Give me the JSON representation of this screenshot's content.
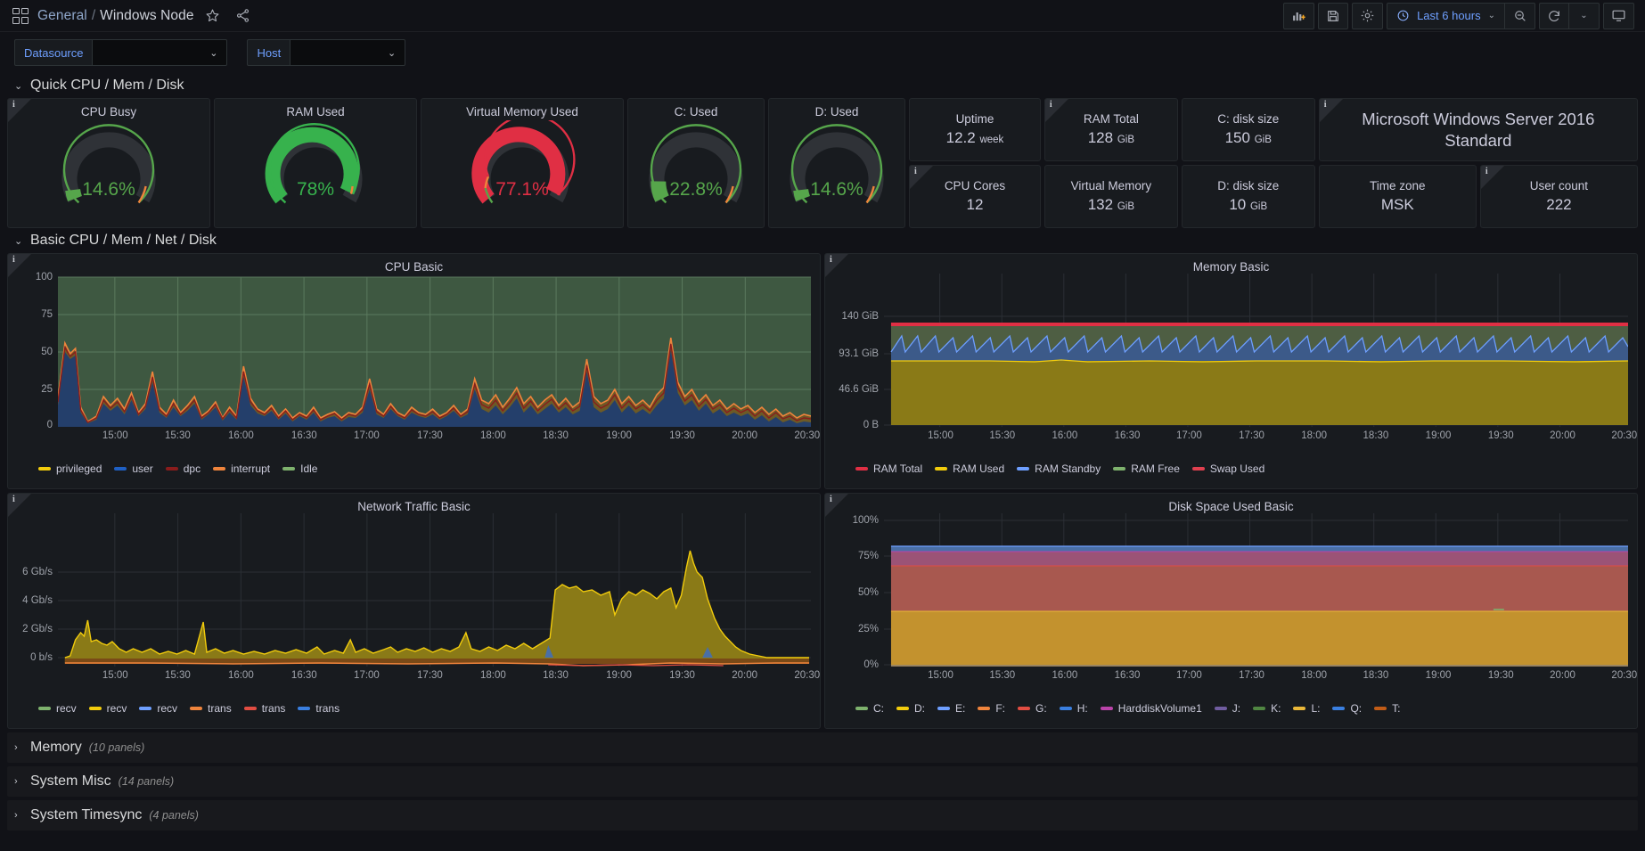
{
  "nav": {
    "breadcrumb_root": "General",
    "breadcrumb_sep": "/",
    "breadcrumb_current": "Windows Node",
    "star_icon": "star-icon",
    "share_icon": "share-icon",
    "grid_icon": "dashboard-grid-icon",
    "add_panel_label": "add-panel-icon",
    "save_label": "save-icon",
    "settings_label": "settings-gear-icon",
    "time_range": "Last 6 hours",
    "zoom_out_label": "zoom-out-icon",
    "refresh_label": "refresh-icon",
    "refresh_interval_caret": "⌄",
    "tv_label": "tv-mode-icon"
  },
  "variables": [
    {
      "label": "Datasource",
      "value": "",
      "name": "datasource"
    },
    {
      "label": "Host",
      "value": "",
      "name": "host"
    }
  ],
  "rows": {
    "quick": {
      "title": "Quick CPU / Mem / Disk",
      "expanded": true
    },
    "basic": {
      "title": "Basic CPU / Mem / Net / Disk",
      "expanded": true
    },
    "memory": {
      "title": "Memory",
      "count": "(10 panels)",
      "expanded": false
    },
    "system_misc": {
      "title": "System Misc",
      "count": "(14 panels)",
      "expanded": false
    },
    "system_timesync": {
      "title": "System Timesync",
      "count": "(4 panels)",
      "expanded": false
    }
  },
  "gauges": [
    {
      "title": "CPU Busy",
      "value": "14.6%",
      "pct": 14.6,
      "color": "#56a64b"
    },
    {
      "title": "RAM Used",
      "value": "78%",
      "pct": 78.0,
      "color": "#37b24d"
    },
    {
      "title": "Virtual Memory Used",
      "value": "77.1%",
      "pct": 77.1,
      "color": "#e02f44"
    },
    {
      "title": "C: Used",
      "value": "22.8%",
      "pct": 22.8,
      "color": "#56a64b"
    },
    {
      "title": "D: Used",
      "value": "14.6%",
      "pct": 14.6,
      "color": "#56a64b"
    }
  ],
  "stats": [
    {
      "name": "Uptime",
      "value": "12.2",
      "unit": "week",
      "info": false
    },
    {
      "name": "RAM Total",
      "value": "128",
      "unit": "GiB",
      "info": true
    },
    {
      "name": "C: disk size",
      "value": "150",
      "unit": "GiB",
      "info": false
    },
    {
      "name": "CPU Cores",
      "value": "12",
      "unit": "",
      "info": true
    },
    {
      "name": "Virtual Memory",
      "value": "132",
      "unit": "GiB",
      "info": false
    },
    {
      "name": "D: disk size",
      "value": "10",
      "unit": "GiB",
      "info": false
    },
    {
      "name": "Time zone",
      "value": "MSK",
      "unit": "",
      "info": false
    },
    {
      "name": "User count",
      "value": "222",
      "unit": "",
      "info": true
    }
  ],
  "os_panel": {
    "text": "Microsoft Windows Server 2016 Standard"
  },
  "chart_data": [
    {
      "type": "area",
      "title": "CPU Basic",
      "ylabel": "",
      "xlabel": "",
      "ylim": [
        0,
        100
      ],
      "yticks": [
        "0",
        "25",
        "50",
        "75",
        "100"
      ],
      "xticks": [
        "15:00",
        "15:30",
        "16:00",
        "16:30",
        "17:00",
        "17:30",
        "18:00",
        "18:30",
        "19:00",
        "19:30",
        "20:00",
        "20:30"
      ],
      "grid": true,
      "legend_position": "bottom",
      "series": [
        {
          "name": "privileged",
          "color": "#f2cc0c"
        },
        {
          "name": "user",
          "color": "#1f60c4"
        },
        {
          "name": "dpc",
          "color": "#8a1c1c"
        },
        {
          "name": "interrupt",
          "color": "#ef843c"
        },
        {
          "name": "Idle",
          "color": "#7eb26d"
        }
      ]
    },
    {
      "type": "area",
      "title": "Memory Basic",
      "ylabel": "",
      "xlabel": "",
      "ylim": [
        0,
        140
      ],
      "yticks": [
        "0 B",
        "46.6 GiB",
        "93.1 GiB",
        "140 GiB"
      ],
      "xticks": [
        "15:00",
        "15:30",
        "16:00",
        "16:30",
        "17:00",
        "17:30",
        "18:00",
        "18:30",
        "19:00",
        "19:30",
        "20:00",
        "20:30"
      ],
      "grid": true,
      "legend_position": "bottom",
      "series": [
        {
          "name": "RAM Total",
          "color": "#e02f44"
        },
        {
          "name": "RAM Used",
          "color": "#f2cc0c"
        },
        {
          "name": "RAM Standby",
          "color": "#6e9fff"
        },
        {
          "name": "RAM Free",
          "color": "#7eb26d"
        },
        {
          "name": "Swap Used",
          "color": "#e0404f"
        }
      ]
    },
    {
      "type": "area",
      "title": "Network Traffic Basic",
      "ylabel": "",
      "xlabel": "",
      "ylim": [
        0,
        7
      ],
      "yticks": [
        "0 b/s",
        "2 Gb/s",
        "4 Gb/s",
        "6 Gb/s"
      ],
      "xticks": [
        "15:00",
        "15:30",
        "16:00",
        "16:30",
        "17:00",
        "17:30",
        "18:00",
        "18:30",
        "19:00",
        "19:30",
        "20:00",
        "20:30"
      ],
      "grid": true,
      "legend_position": "bottom",
      "series": [
        {
          "name": "recv",
          "color": "#7eb26d"
        },
        {
          "name": "recv",
          "color": "#f2cc0c"
        },
        {
          "name": "recv",
          "color": "#6e9fff"
        },
        {
          "name": "trans",
          "color": "#ef843c"
        },
        {
          "name": "trans",
          "color": "#e24d42"
        },
        {
          "name": "trans",
          "color": "#3a7fe0"
        }
      ]
    },
    {
      "type": "area",
      "title": "Disk Space Used Basic",
      "ylabel": "",
      "xlabel": "",
      "ylim": [
        0,
        100
      ],
      "yticks": [
        "0%",
        "25%",
        "50%",
        "75%",
        "100%"
      ],
      "xticks": [
        "15:00",
        "15:30",
        "16:00",
        "16:30",
        "17:00",
        "17:30",
        "18:00",
        "18:30",
        "19:00",
        "19:30",
        "20:00",
        "20:30"
      ],
      "grid": true,
      "legend_position": "bottom",
      "series": [
        {
          "name": "C:",
          "color": "#7eb26d"
        },
        {
          "name": "D:",
          "color": "#f2cc0c"
        },
        {
          "name": "E:",
          "color": "#6e9fff"
        },
        {
          "name": "F:",
          "color": "#ef843c"
        },
        {
          "name": "G:",
          "color": "#e24d42"
        },
        {
          "name": "H:",
          "color": "#3a7fe0"
        },
        {
          "name": "HarddiskVolume1",
          "color": "#ba43a9"
        },
        {
          "name": "J:",
          "color": "#705da0"
        },
        {
          "name": "K:",
          "color": "#508642"
        },
        {
          "name": "L:",
          "color": "#eab839"
        },
        {
          "name": "Q:",
          "color": "#3a7fe0"
        },
        {
          "name": "T:",
          "color": "#c15c17"
        }
      ]
    }
  ]
}
